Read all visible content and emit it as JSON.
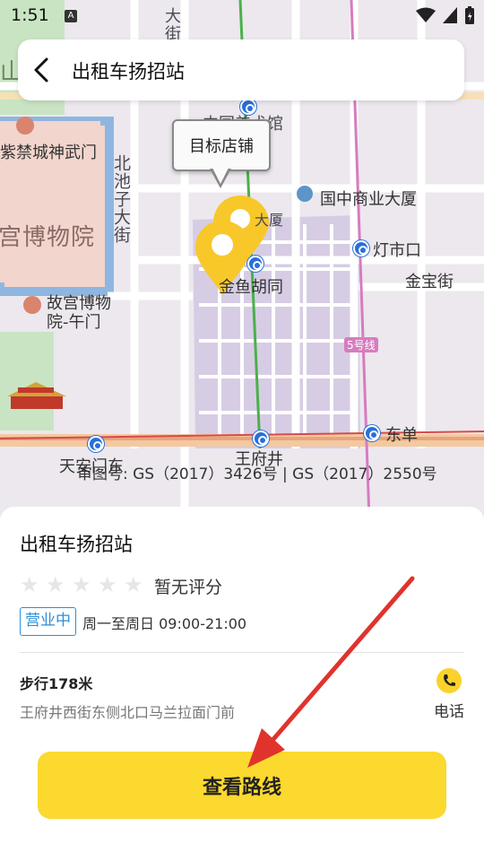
{
  "status_bar": {
    "time": "1:51",
    "a_icon": "A"
  },
  "header": {
    "title": "出租车扬招站"
  },
  "map": {
    "callout_label": "目标店铺",
    "labels": {
      "forbidden_city_shenwu": "紫禁城神武门",
      "palace_museum": "宫博物院",
      "palace_museum_wumen_1": "故宫博物",
      "palace_museum_wumen_2": "院-午门",
      "beichizi": "北池子大街",
      "meishuguan": "中国美术馆",
      "guozhong": "国中商业大厦",
      "dengshikou": "灯市口",
      "jinbaojie": "金宝街",
      "jinyuhutong": "金鱼胡同",
      "line5": "5号线",
      "dongdan": "东单",
      "wangfujing": "王府井",
      "tiananmen_east": "天安门东",
      "shan": "山",
      "da": "大",
      "jie": "街",
      "hutong_center": "大厦"
    },
    "copyright": "审图号: GS（2017）3426号 | GS（2017）2550号"
  },
  "place": {
    "name": "出租车扬招站",
    "rating_text": "暂无评分",
    "star_count": 5,
    "rating_value": 0,
    "status_badge": "营业中",
    "hours": "周一至周日 09:00-21:00",
    "walk_distance": "步行178米",
    "address": "王府井西街东侧北口马兰拉面门前",
    "phone_label": "电话",
    "route_button": "查看路线"
  },
  "colors": {
    "accent_yellow": "#fbd92f",
    "badge_blue": "#2a8fd8",
    "annotation_arrow": "#e0332c"
  }
}
